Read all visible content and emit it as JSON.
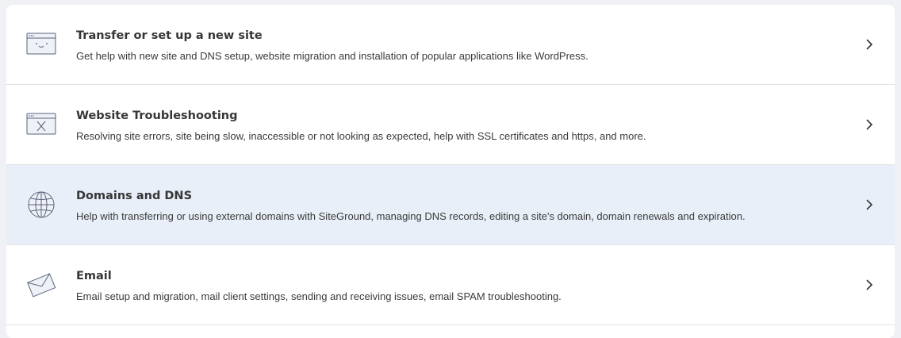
{
  "colors": {
    "active_row_bg": "#e9eff9",
    "icon_stroke": "#5a6479",
    "icon_fill": "#eef1f8"
  },
  "items": [
    {
      "title": "Transfer or set up a new site",
      "description": "Get help with new site and DNS setup, website migration and installation of popular applications like WordPress.",
      "icon": "browser-window-smile-icon"
    },
    {
      "title": "Website Troubleshooting",
      "description": "Resolving site errors, site being slow, inaccessible or not looking as expected, help with SSL certificates and https, and more.",
      "icon": "browser-window-error-icon"
    },
    {
      "title": "Domains and DNS",
      "description": "Help with transferring or using external domains with SiteGround, managing DNS records, editing a site's domain, domain renewals and expiration.",
      "icon": "globe-icon",
      "active": true
    },
    {
      "title": "Email",
      "description": "Email setup and migration, mail client settings, sending and receiving issues, email SPAM troubleshooting.",
      "icon": "envelope-icon"
    }
  ]
}
